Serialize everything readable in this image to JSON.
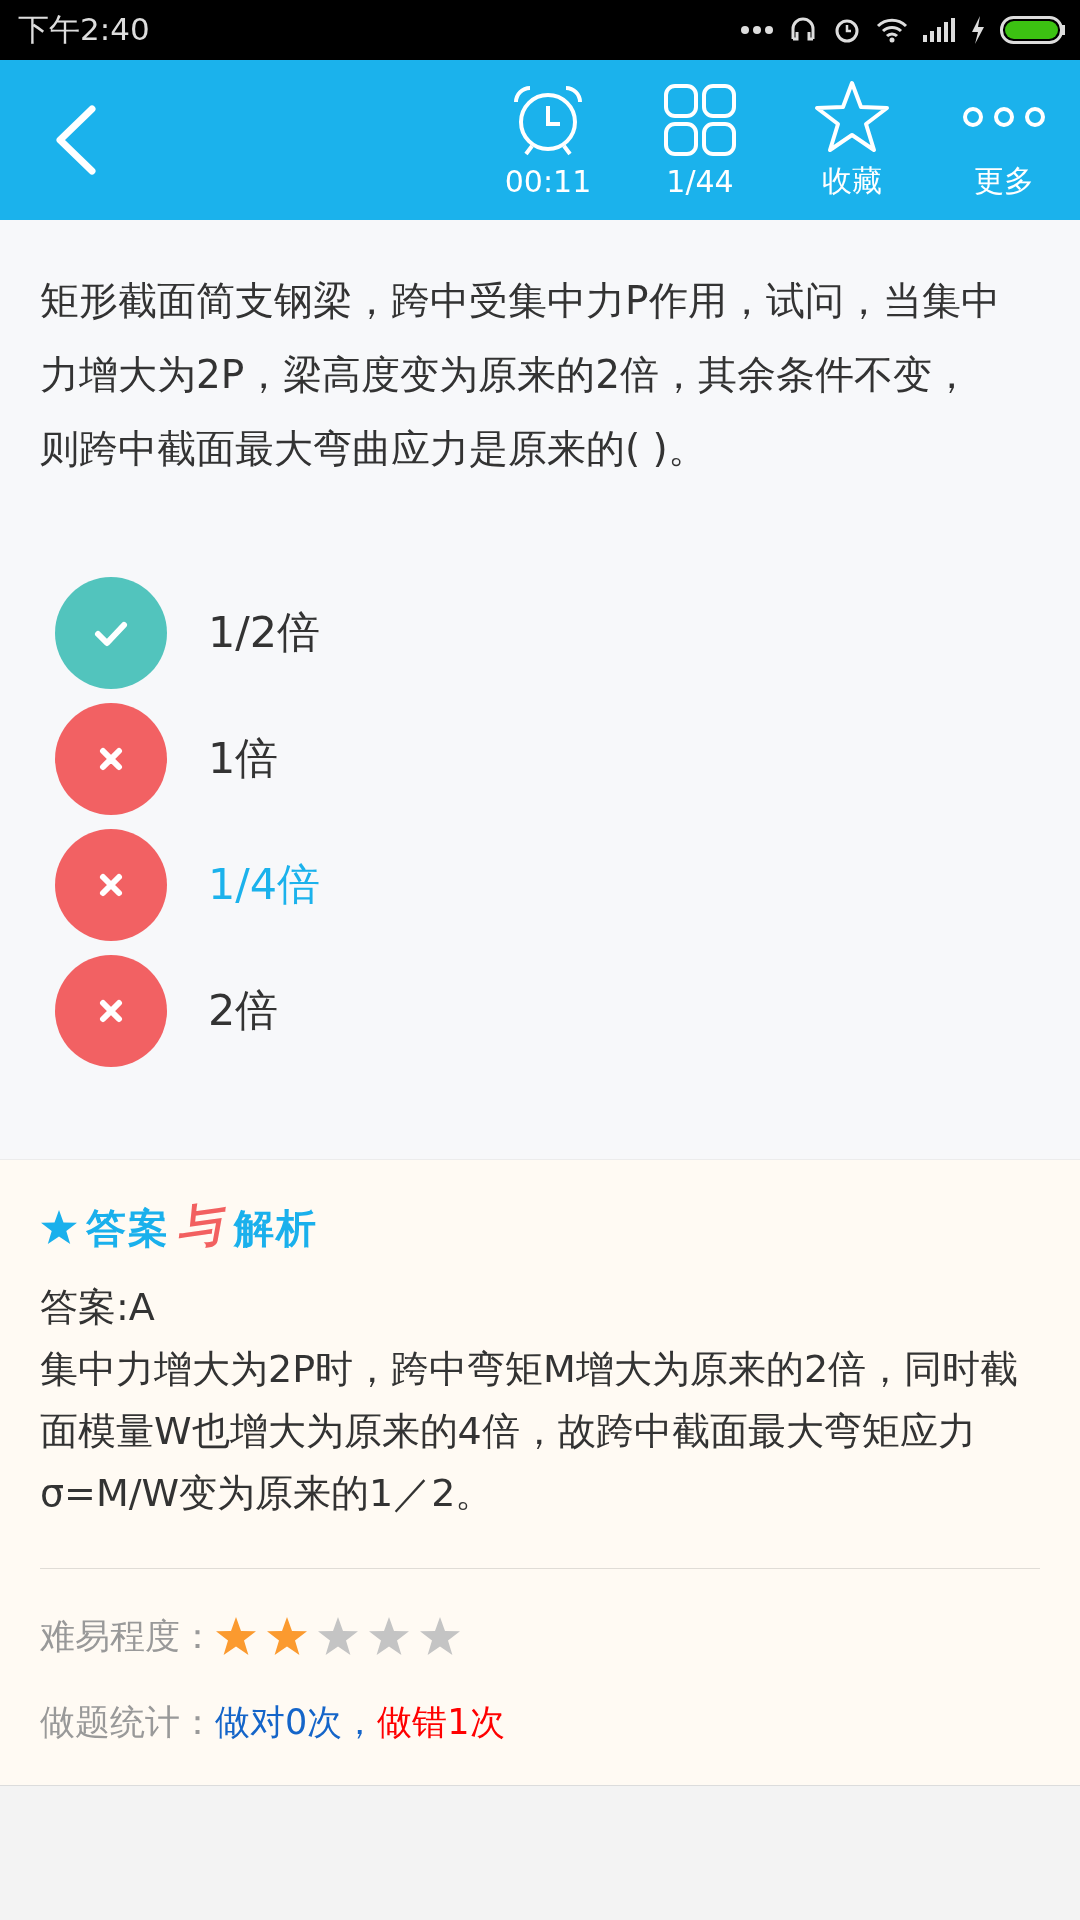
{
  "status_bar": {
    "time": "下午2:40"
  },
  "toolbar": {
    "items": [
      {
        "kind": "timer",
        "label": "00:11"
      },
      {
        "kind": "grid",
        "label": "1/44"
      },
      {
        "kind": "star",
        "label": "收藏"
      },
      {
        "kind": "more",
        "label": "更多"
      }
    ]
  },
  "question": {
    "text": "矩形截面简支钢梁，跨中受集中力P作用，试问，当集中力增大为2P，梁高度变为原来的2倍，其余条件不变，则跨中截面最大弯曲应力是原来的(   )。",
    "options": [
      {
        "label": "1/2倍",
        "kind": "correct",
        "selected": false
      },
      {
        "label": "1倍",
        "kind": "wrong",
        "selected": false
      },
      {
        "label": "1/4倍",
        "kind": "wrong",
        "selected": true
      },
      {
        "label": "2倍",
        "kind": "wrong",
        "selected": false
      }
    ]
  },
  "analysis": {
    "heading": [
      {
        "text": "答案",
        "color": "#1ab0ec"
      },
      {
        "text": "与",
        "color": "#f26060"
      },
      {
        "text": "解析",
        "color": "#1ab0ec"
      }
    ],
    "answer": "答案:A",
    "explanation": "集中力增大为2P时，跨中弯矩M增大为原来的2倍，同时截面模量W也增大为原来的4倍，故跨中截面最大弯矩应力σ=M/W变为原来的1／2。",
    "difficulty_label": "难易程度：",
    "stars": 2,
    "stats_label": "做题统计：",
    "stats_correct": "做对0次，",
    "stats_wrong": "做错1次"
  }
}
